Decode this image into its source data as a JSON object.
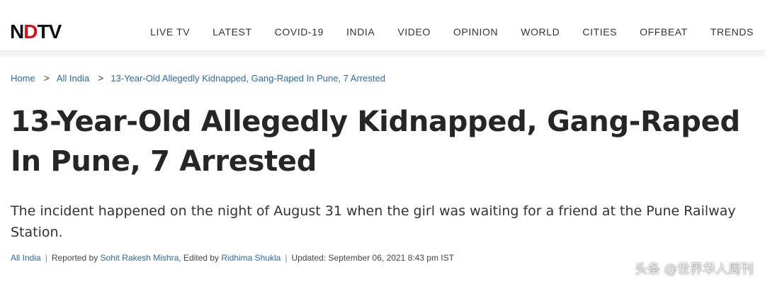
{
  "header": {
    "logo_left": "N",
    "logo_mid": "D",
    "logo_right": "TV",
    "nav": [
      "LIVE TV",
      "LATEST",
      "COVID-19",
      "INDIA",
      "VIDEO",
      "OPINION",
      "WORLD",
      "CITIES",
      "OFFBEAT",
      "TRENDS"
    ]
  },
  "breadcrumb": {
    "home": "Home",
    "section": "All India",
    "current": "13-Year-Old Allegedly Kidnapped, Gang-Raped In Pune, 7 Arrested",
    "separator": ">"
  },
  "article": {
    "headline": "13-Year-Old Allegedly Kidnapped, Gang-Raped In Pune, 7 Arrested",
    "summary": "The incident happened on the night of August 31 when the girl was waiting for a friend at the Pune Railway Station.",
    "byline": {
      "section": "All India",
      "reported_prefix": "Reported by",
      "reporter": "Sohit Rakesh Mishra",
      "edited_prefix": ", Edited by",
      "editor": "Ridhima Shukla",
      "updated": "Updated: September 06, 2021 8:43 pm IST",
      "divider": "|"
    }
  },
  "watermark": "头条 @世界华人周刊",
  "colors": {
    "link": "#2a6ab1",
    "logo_accent": "#d4101a",
    "headline": "#262626"
  }
}
